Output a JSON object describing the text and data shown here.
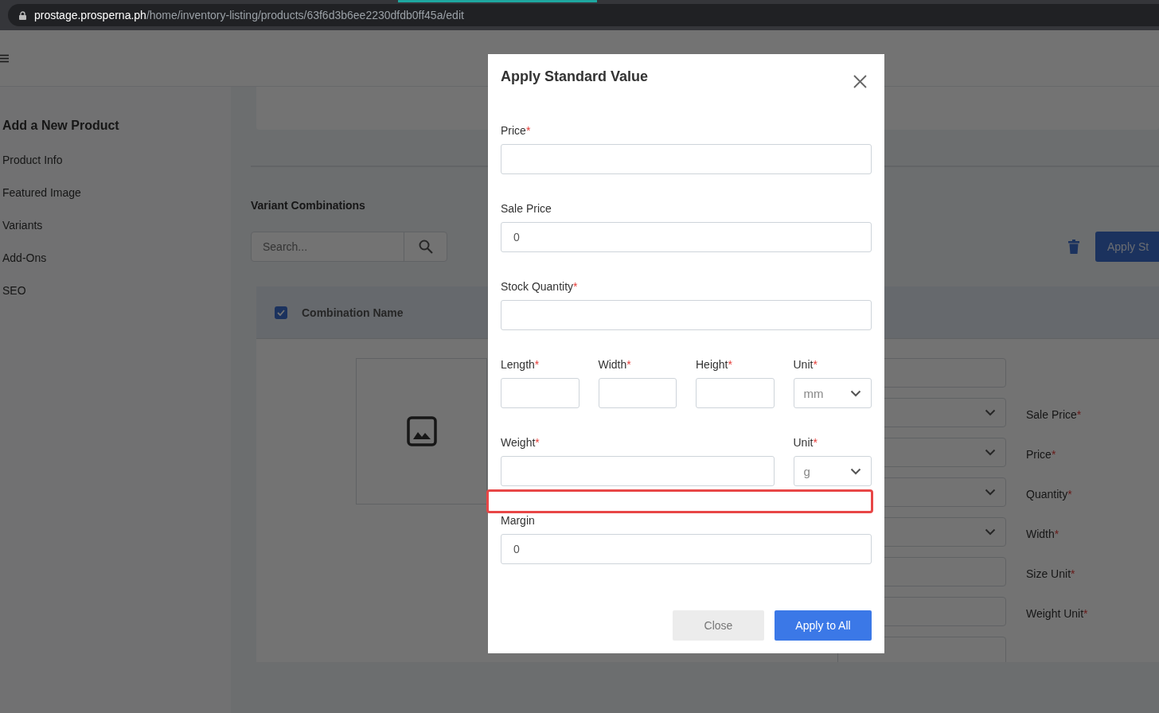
{
  "browser": {
    "url_host": "prostage.prosperna.ph",
    "url_path": "/home/inventory-listing/products/63f6d3b6ee2230dfdb0ff45a/edit"
  },
  "sidebar": {
    "title": "Add a New Product",
    "items": [
      {
        "label": "Product Info"
      },
      {
        "label": "Featured Image"
      },
      {
        "label": "Variants"
      },
      {
        "label": "Add-Ons"
      },
      {
        "label": "SEO"
      }
    ]
  },
  "variants": {
    "title": "Variant Combinations",
    "search": {
      "placeholder": "Search..."
    },
    "apply_button": "Apply St",
    "table": {
      "select_all_checked": true,
      "column_header": "Combination Name",
      "fields": [
        {
          "kind": "input"
        },
        {
          "kind": "select"
        },
        {
          "kind": "select"
        },
        {
          "kind": "select"
        },
        {
          "kind": "select"
        },
        {
          "kind": "input"
        },
        {
          "kind": "input"
        },
        {
          "kind": "input"
        }
      ],
      "labels": [
        {
          "text": "Sale Price",
          "required_mark": "*"
        },
        {
          "text": "Price",
          "required_mark": "*"
        },
        {
          "text": "Quantity",
          "required_mark": "*"
        },
        {
          "text": "Width",
          "required_mark": "*"
        },
        {
          "text": "Size Unit",
          "required_mark": "*"
        },
        {
          "text": "Weight Unit",
          "required_mark": "*"
        }
      ]
    }
  },
  "modal": {
    "title": "Apply Standard Value",
    "rows": [
      [
        {
          "label": "Price",
          "required_mark": "*",
          "kind": "input"
        }
      ],
      [
        {
          "label": "Sale Price",
          "kind": "input",
          "value": "0"
        }
      ],
      [
        {
          "label": "Stock Quantity",
          "required_mark": "*",
          "kind": "input"
        }
      ],
      [
        {
          "label": "Length",
          "required_mark": "*",
          "kind": "input"
        },
        {
          "label": "Width",
          "required_mark": "*",
          "kind": "input"
        },
        {
          "label": "Height",
          "required_mark": "*",
          "kind": "input"
        },
        {
          "label": "Unit",
          "required_mark": "*",
          "kind": "select",
          "value": "mm"
        }
      ],
      [
        {
          "label": "Weight",
          "required_mark": "*",
          "kind": "input"
        },
        "",
        "",
        {
          "label": "Unit",
          "required_mark": "*",
          "kind": "select",
          "value": "g"
        }
      ],
      [
        {
          "label": "Margin",
          "kind": "input",
          "value": "0",
          "highlighted": true
        }
      ]
    ],
    "buttons": [
      {
        "label": "Close",
        "kind": "secondary"
      },
      {
        "label": "Apply to All",
        "kind": "primary"
      }
    ]
  }
}
